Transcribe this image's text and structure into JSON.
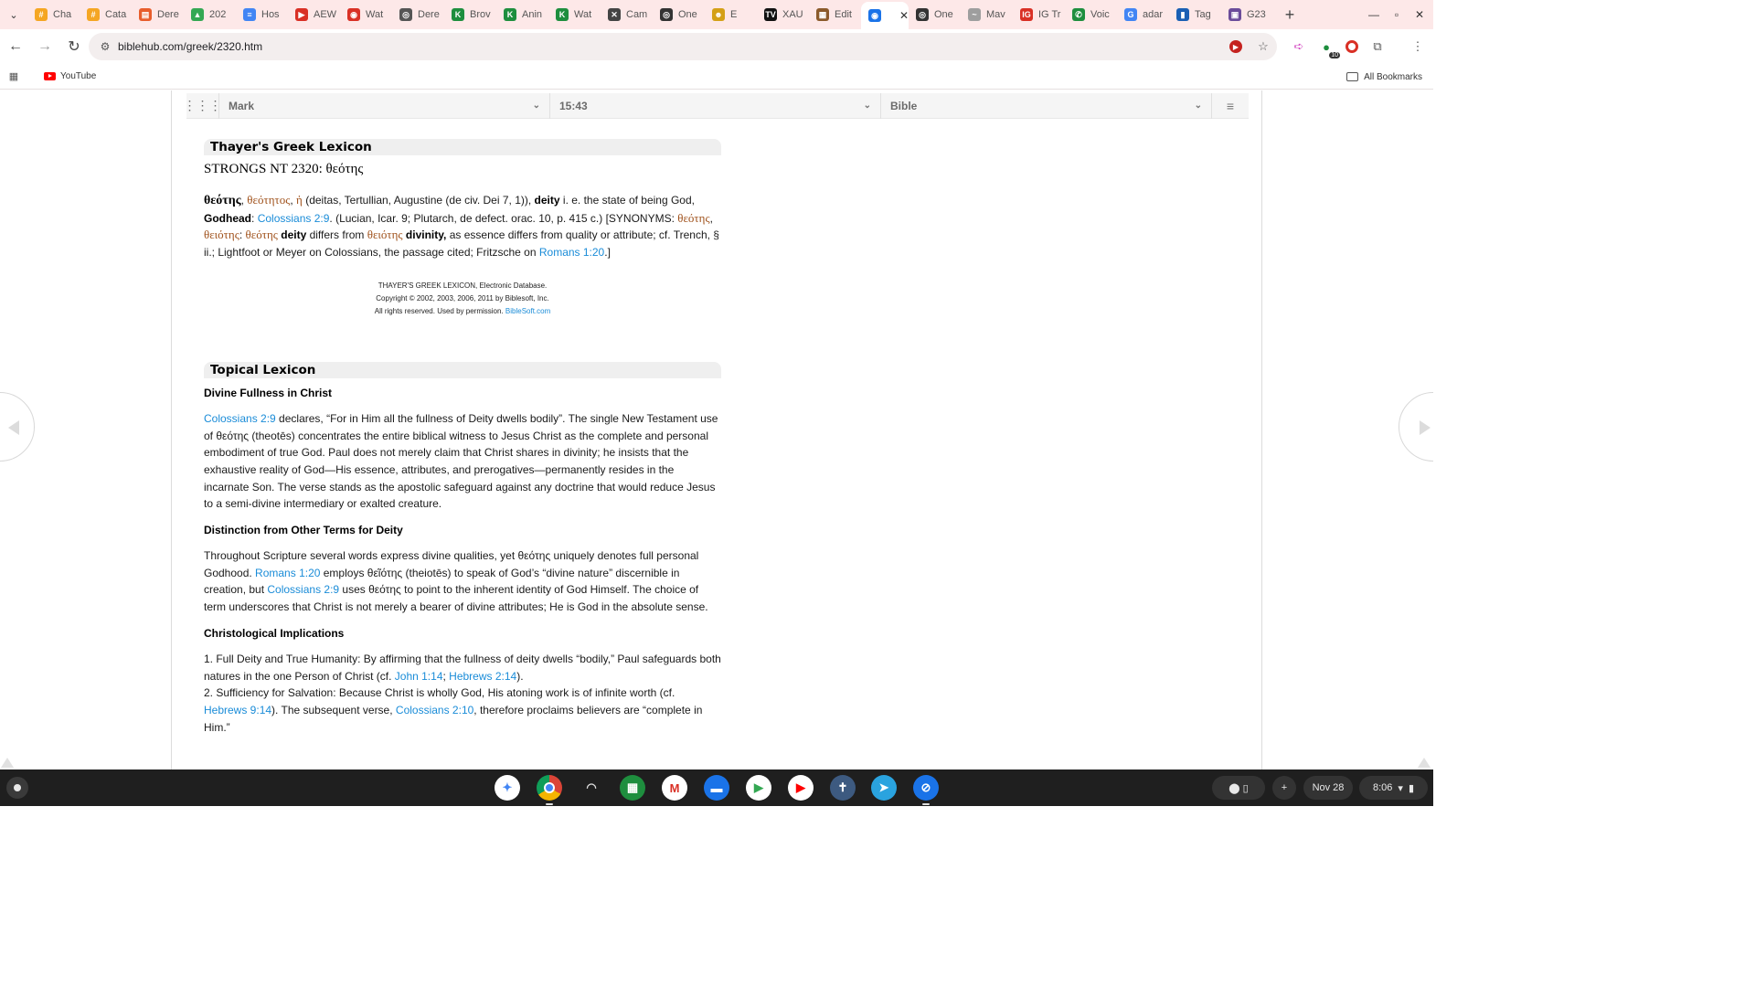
{
  "browser": {
    "tabs": [
      {
        "title": "Cha",
        "fav_glyph": "#",
        "fav_color": "#f5a623"
      },
      {
        "title": "Cata",
        "fav_glyph": "#",
        "fav_color": "#f5a623"
      },
      {
        "title": "Dere",
        "fav_glyph": "▤",
        "fav_color": "#e85d2c"
      },
      {
        "title": "202",
        "fav_glyph": "▲",
        "fav_color": "#34a853"
      },
      {
        "title": "Hos",
        "fav_glyph": "≡",
        "fav_color": "#4285f4"
      },
      {
        "title": "AEW",
        "fav_glyph": "▶",
        "fav_color": "#d93025"
      },
      {
        "title": "Wat",
        "fav_glyph": "◉",
        "fav_color": "#d93025"
      },
      {
        "title": "Dere",
        "fav_glyph": "◎",
        "fav_color": "#555555"
      },
      {
        "title": "Brov",
        "fav_glyph": "K",
        "fav_color": "#1e8e3e"
      },
      {
        "title": "Anin",
        "fav_glyph": "K",
        "fav_color": "#1e8e3e"
      },
      {
        "title": "Wat",
        "fav_glyph": "K",
        "fav_color": "#1e8e3e"
      },
      {
        "title": "Cam",
        "fav_glyph": "✕",
        "fav_color": "#444444"
      },
      {
        "title": "One",
        "fav_glyph": "◎",
        "fav_color": "#333333"
      },
      {
        "title": "E",
        "fav_glyph": "☻",
        "fav_color": "#d4a017"
      },
      {
        "title": "XAU",
        "fav_glyph": "TV",
        "fav_color": "#111111"
      },
      {
        "title": "Edit",
        "fav_glyph": "▦",
        "fav_color": "#8b5a2b"
      },
      {
        "title": "",
        "fav_glyph": "◉",
        "fav_color": "#1a73e8",
        "active": true
      },
      {
        "title": "One",
        "fav_glyph": "◎",
        "fav_color": "#333333"
      },
      {
        "title": "Mav",
        "fav_glyph": "~",
        "fav_color": "#9e9e9e"
      },
      {
        "title": "IG Tr",
        "fav_glyph": "IG",
        "fav_color": "#d93025"
      },
      {
        "title": "Voic",
        "fav_glyph": "✆",
        "fav_color": "#1e8e3e"
      },
      {
        "title": "adar",
        "fav_glyph": "G",
        "fav_color": "#4285f4"
      },
      {
        "title": "Tag",
        "fav_glyph": "▮",
        "fav_color": "#1a5fb4"
      },
      {
        "title": "G23",
        "fav_glyph": "▣",
        "fav_color": "#6b4c9a"
      }
    ],
    "url": "biblehub.com/greek/2320.htm",
    "bookmarks": [
      {
        "label": "YouTube"
      }
    ],
    "all_bookmarks": "All Bookmarks",
    "ext_badge": "10"
  },
  "selector": {
    "book": "Mark",
    "verse": "15:43",
    "version": "Bible"
  },
  "thayers": {
    "heading": "Thayer's Greek Lexicon",
    "strongs": "STRONGS NT 2320: θεότης",
    "entry": {
      "headword": "θεότης",
      "genitive": "θεότητος",
      "article": "ἡ",
      "t1": " (deitas, Tertullian, Augustine (de civ. Dei 7, 1)), ",
      "deity": "deity",
      "t2": " i. e. the state of being God, ",
      "godhead": "Godhead",
      "t3": ": ",
      "ref1": "Colossians 2:9",
      "t4": ". (Lucian, Icar. 9; Plutarch, de defect. orac. 10, p. 415 c.) [SYNONYMS: ",
      "syn1": "θεότης",
      "syn2": "θειότης",
      "t5": ": ",
      "syn3": "θεότης",
      "deity2": "deity",
      "t6": " differs from ",
      "syn4": "θειότης",
      "divinity": "divinity,",
      "t7": " as essence differs from quality or attribute; cf. Trench, § ii.; Lightfoot or Meyer on Colossians, the passage cited; Fritzsche on ",
      "ref2": "Romans 1:20",
      "t8": ".]"
    },
    "copyright": {
      "line1": "THAYER'S GREEK LEXICON, Electronic Database.",
      "line2": "Copyright © 2002, 2003, 2006, 2011 by Biblesoft, Inc.",
      "line3": "All rights reserved. Used by permission. ",
      "link": "BibleSoft.com"
    }
  },
  "topical": {
    "heading": "Topical Lexicon",
    "s1_title": "Divine Fullness in Christ",
    "s1": {
      "ref": "Colossians 2:9",
      "text": " declares, “For in Him all the fullness of Deity dwells bodily”. The single New Testament use of θεότης (theotēs) concentrates the entire biblical witness to Jesus Christ as the complete and personal embodiment of true God. Paul does not merely claim that Christ shares in divinity; he insists that the exhaustive reality of God—His essence, attributes, and prerogatives—permanently resides in the incarnate Son. The verse stands as the apostolic safeguard against any doctrine that would reduce Jesus to a semi-divine intermediary or exalted creature."
    },
    "s2_title": "Distinction from Other Terms for Deity",
    "s2": {
      "t1": "Throughout Scripture several words express divine qualities, yet θεότης uniquely denotes full personal Godhood. ",
      "ref1": "Romans 1:20",
      "t2": " employs θεῖότης (theiotēs) to speak of God’s “divine nature” discernible in creation, but ",
      "ref2": "Colossians 2:9",
      "t3": " uses θεότης to point to the inherent identity of God Himself. The choice of term underscores that Christ is not merely a bearer of divine attributes; He is God in the absolute sense."
    },
    "s3_title": "Christological Implications",
    "s3": {
      "i1_t1": "1. Full Deity and True Humanity: By affirming that the fullness of deity dwells “bodily,” Paul safeguards both natures in the one Person of Christ (cf. ",
      "i1_ref1": "John 1:14",
      "i1_sep": "; ",
      "i1_ref2": "Hebrews 2:14",
      "i1_t2": ").",
      "i2_t1": "2. Sufficiency for Salvation: Because Christ is wholly God, His atoning work is of infinite worth (cf. ",
      "i2_ref1": "Hebrews 9:14",
      "i2_t2": "). The subsequent verse, ",
      "i2_ref2": "Colossians 2:10",
      "i2_t3": ", therefore proclaims believers are “complete in Him.”"
    }
  },
  "shelf": {
    "date": "Nov 28",
    "time": "8:06"
  },
  "colors": {
    "link": "#1a8cd8",
    "greek": "#a0521c",
    "tabstrip": "#fde8e8",
    "shelf": "#1f1f1f"
  }
}
